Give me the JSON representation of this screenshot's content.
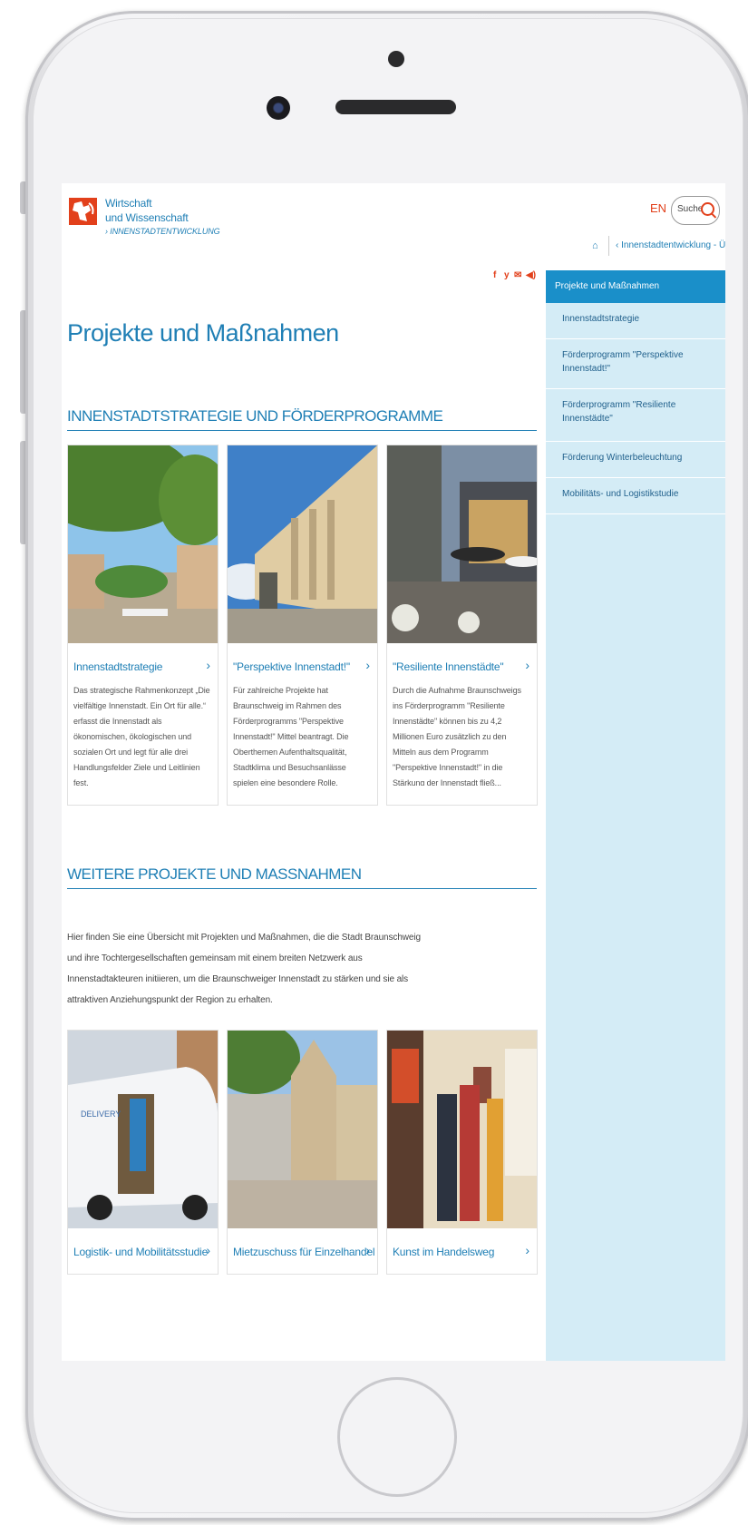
{
  "header": {
    "brand_line1": "Wirtschaft",
    "brand_line2": "und Wissenschaft",
    "brand_sub": "› INNENSTADTENTWICKLUNG",
    "lang": "EN",
    "search_label": "Suche",
    "breadcrumb": "‹  Innenstadtentwicklung - Übe...",
    "social": [
      "f",
      "y",
      "✉",
      "◀)"
    ]
  },
  "sidebar": {
    "active": "Projekte und Maßnahmen",
    "items": [
      {
        "label": "Innenstadtstrategie"
      },
      {
        "label": "Förderprogramm \"Perspektive Innenstadt!\""
      },
      {
        "label": "Förderprogramm \"Resiliente Innenstädte\""
      },
      {
        "label": "Förderung Winterbeleuchtung"
      },
      {
        "label": "Mobilitäts- und Logistikstudie"
      }
    ]
  },
  "main": {
    "title": "Projekte und Maßnahmen",
    "section1_title": "INNENSTADTSTRATEGIE UND FÖRDERPROGRAMME",
    "section1_cards": [
      {
        "title": "Innenstadtstrategie",
        "arrow": "›",
        "text": "Das strategische Rahmenkonzept „Die vielfältige Innenstadt. Ein Ort für alle.“ erfasst die Innenstadt als ökonomischen, ökologischen und sozialen Ort und legt für alle drei Handlungsfelder Ziele und Leitlinien fest."
      },
      {
        "title": "\"Perspektive Innenstadt!\"",
        "arrow": "›",
        "text": "Für zahlreiche Projekte hat Braunschweig im Rahmen des Förderprogramms \"Perspektive Innenstadt!\" Mittel beantragt. Die Oberthemen Aufenthaltsqualität, Stadtklima und Besuchsanlässe spielen eine besondere Rolle."
      },
      {
        "title": "\"Resiliente Innenstädte\"",
        "arrow": "›",
        "text": "Durch die Aufnahme Braunschweigs ins Förderprogramm \"Resiliente Innenstädte\" können bis zu 4,2 Millionen Euro zusätzlich zu den Mitteln aus dem Programm \"Perspektive Innenstadt!\" in die Stärkung der Innenstadt fließ..."
      }
    ],
    "section2_title": "WEITERE PROJEKTE UND MASSNAHMEN",
    "section2_intro": "Hier finden Sie eine Übersicht mit Projekten und Maßnahmen, die die Stadt Braunschweig und ihre Tochtergesellschaften gemeinsam mit einem breiten Netzwerk aus Innenstadtakteuren initiieren, um die Braunschweiger Innenstadt zu stärken und sie als attraktiven Anziehungspunkt der Region zu erhalten.",
    "section2_cards": [
      {
        "title": "Logistik- und Mobilitätsstudie",
        "arrow": "›",
        "van_text": "DELIVERY"
      },
      {
        "title": "Mietzuschuss für Einzelhandel",
        "arrow": "›"
      },
      {
        "title": "Kunst im Handelsweg",
        "arrow": "›"
      }
    ]
  },
  "colors": {
    "brand_blue": "#1f7fb5",
    "brand_red": "#e2401b",
    "sidebar_bg": "#d4ecf6",
    "sidebar_active": "#1a8fc9"
  }
}
